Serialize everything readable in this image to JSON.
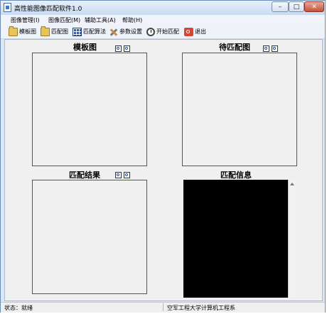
{
  "window": {
    "title": "高性能图像匹配软件1.0"
  },
  "window_controls": {
    "minimize": "–",
    "maximize": "□",
    "close": "✕"
  },
  "menu": [
    {
      "label": "图像管理(I)"
    },
    {
      "label": "图像匹配(M)"
    },
    {
      "label": "辅助工具(A)"
    },
    {
      "label": "帮助(H)"
    }
  ],
  "toolbar": [
    {
      "label": "模板图",
      "icon": "open-folder-icon"
    },
    {
      "label": "匹配图",
      "icon": "open-folder-icon"
    },
    {
      "label": "匹配算法",
      "icon": "grid-table-icon"
    },
    {
      "label": "参数设置",
      "icon": "tools-icon"
    },
    {
      "label": "开始匹配",
      "icon": "clock-icon"
    },
    {
      "label": "退出",
      "icon": "exit-icon"
    }
  ],
  "panels": {
    "template": {
      "title": "模板图"
    },
    "target": {
      "title": "待匹配图"
    },
    "result": {
      "title": "匹配结果"
    },
    "info": {
      "title": "匹配信息"
    }
  },
  "status": {
    "left": "状态：就绪",
    "right": "空军工程大学计算机工程系"
  },
  "colors": {
    "info_background": "#000000",
    "window_frame": "#dbe7f5",
    "close_button": "#c7503a"
  }
}
